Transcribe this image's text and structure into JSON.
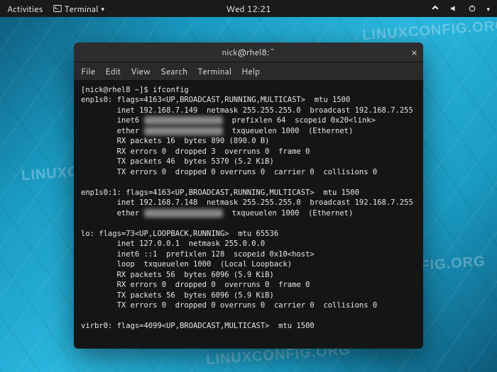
{
  "topbar": {
    "activities": "Activities",
    "app_icon": "terminal-icon",
    "app_name": "Terminal",
    "clock": "Wed 12:21",
    "tray": [
      "network-icon",
      "volume-icon",
      "power-icon"
    ]
  },
  "watermark": "LINUXCONFIG.ORG",
  "window": {
    "title": "nick@rhel8:~",
    "close_label": "×"
  },
  "menubar": [
    "File",
    "Edit",
    "View",
    "Search",
    "Terminal",
    "Help"
  ],
  "prompt": "[nick@rhel8 ~]$ ",
  "command": "ifconfig",
  "output_lines": [
    "enp1s0: flags=4163<UP,BROADCAST,RUNNING,MULTICAST>  mtu 1500",
    "        inet 192.168.7.149  netmask 255.255.255.0  broadcast 192.168.7.255",
    "        inet6 [REDACTED]  prefixlen 64  scopeid 0x20<link>",
    "        ether [REDACTED]  txqueuelen 1000  (Ethernet)",
    "        RX packets 16  bytes 890 (890.0 B)",
    "        RX errors 0  dropped 3  overruns 0  frame 0",
    "        TX packets 46  bytes 5370 (5.2 KiB)",
    "        TX errors 0  dropped 0 overruns 0  carrier 0  collisions 0",
    "",
    "enp1s0:1: flags=4163<UP,BROADCAST,RUNNING,MULTICAST>  mtu 1500",
    "        inet 192.168.7.148  netmask 255.255.255.0  broadcast 192.168.7.255",
    "        ether [REDACTED]  txqueuelen 1000  (Ethernet)",
    "",
    "lo: flags=73<UP,LOOPBACK,RUNNING>  mtu 65536",
    "        inet 127.0.0.1  netmask 255.0.0.0",
    "        inet6 ::1  prefixlen 128  scopeid 0x10<host>",
    "        loop  txqueuelen 1000  (Local Loopback)",
    "        RX packets 56  bytes 6096 (5.9 KiB)",
    "        RX errors 0  dropped 0  overruns 0  frame 0",
    "        TX packets 56  bytes 6096 (5.9 KiB)",
    "        TX errors 0  dropped 0 overruns 0  carrier 0  collisions 0",
    "",
    "virbr0: flags=4099<UP,BROADCAST,MULTICAST>  mtu 1500"
  ]
}
